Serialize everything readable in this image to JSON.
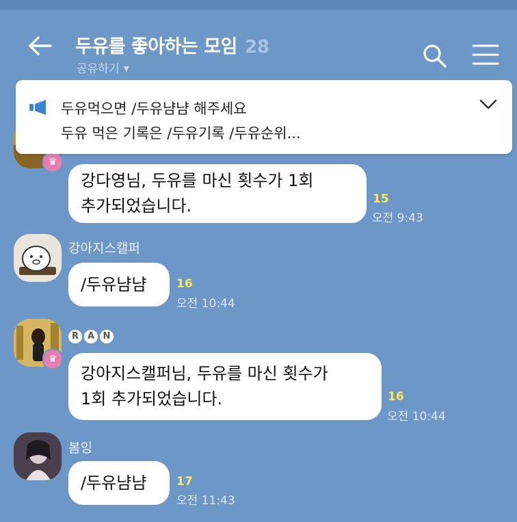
{
  "header": {
    "title": "두유를 좋아하는 모임",
    "member_count": "28",
    "share_label": "공유하기",
    "caret": "▼"
  },
  "notice": {
    "line1": "두유먹으면 /두유냠냠 해주세요",
    "line2": "두유 먹은 기록은 /두유기록 /두유순위..."
  },
  "messages": [
    {
      "sender": "",
      "lines": [
        "강다영님, 두유를 마신 횟수가 1회",
        "추가되었습니다."
      ],
      "unread": "15",
      "time": "오전 9:43"
    },
    {
      "sender": "강아지스캘퍼",
      "lines": [
        "/두유냠냠"
      ],
      "unread": "16",
      "time": "오전 10:44"
    },
    {
      "sender_badges": [
        "R",
        "A",
        "N"
      ],
      "lines": [
        "강아지스캘퍼님, 두유를 마신 횟수가",
        "1회 추가되었습니다."
      ],
      "unread": "16",
      "time": "오전 10:44"
    },
    {
      "sender": "봄잉",
      "lines": [
        "/두유냠냠"
      ],
      "unread": "17",
      "time": "오전 11:43"
    }
  ],
  "colors": {
    "background": "#6d97c7",
    "unread": "#f7e85d",
    "crown_badge": "#e47fb3"
  },
  "icons": {
    "back": "arrow-left-icon",
    "search": "search-icon",
    "menu": "hamburger-menu-icon",
    "notice": "megaphone-icon",
    "expand": "chevron-down-icon",
    "crown": "crown-icon"
  }
}
